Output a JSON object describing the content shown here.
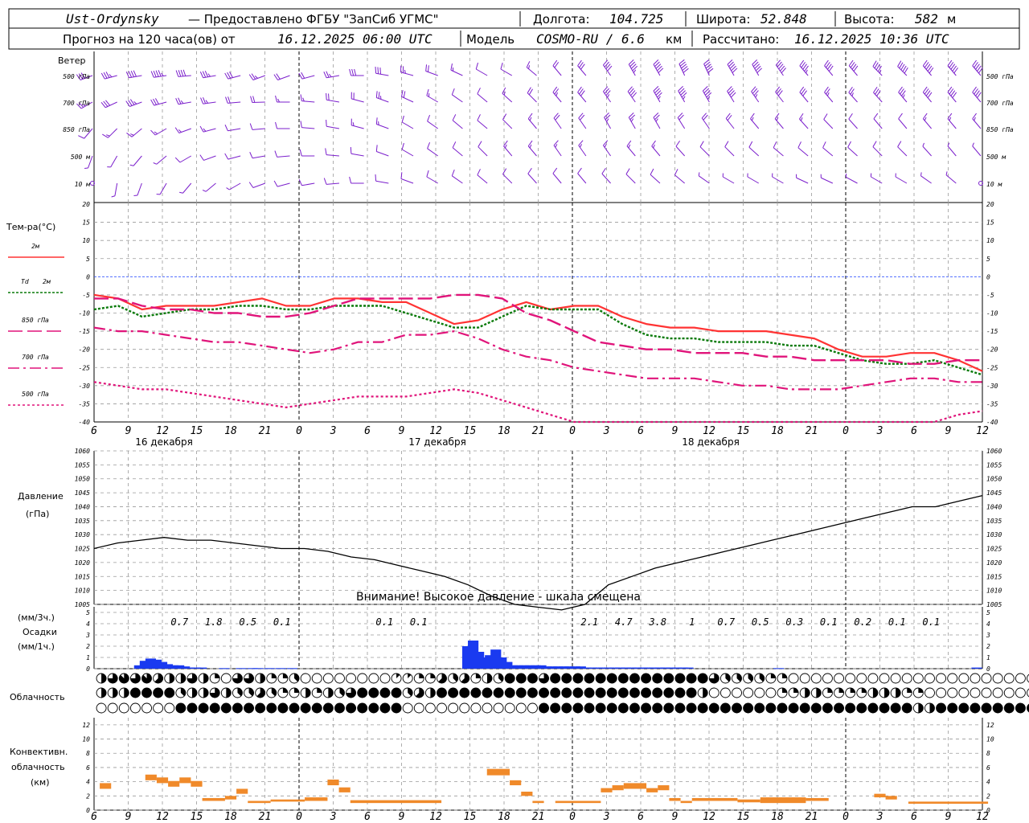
{
  "header": {
    "line1": {
      "station": "Ust-Ordynsky",
      "provider": "— Предоставлено ФГБУ \"ЗапСиб УГМС\"",
      "lon_label": "Долгота:",
      "lon_value": "104.725",
      "lat_label": "Широта:",
      "lat_value": "52.848",
      "alt_label": "Высота:",
      "alt_value": "582",
      "alt_unit": "м"
    },
    "line2": {
      "forecast_label": "Прогноз на 120 часа(ов) от",
      "forecast_start": "16.12.2025 06:00 UTC",
      "model_label": "Модель",
      "model_name": "COSMO-RU / 6.6",
      "model_unit": "км",
      "calc_label": "Рассчитано:",
      "calc_time": "16.12.2025 10:36 UTC"
    }
  },
  "labels": {
    "wind_title": "Ветер",
    "wind_levels": [
      "500 гПа",
      "700 гПа",
      "850 гПа",
      "500 м",
      "10 м"
    ],
    "temp_title": "Тем-ра(°С)",
    "temp_legend": [
      "2м",
      "Td 2м",
      "850 гПа",
      "700 гПа",
      "500 гПа"
    ],
    "pressure_title": "Давление",
    "pressure_unit": "(гПа)",
    "pressure_warning": "Внимание! Высокое давление - шкала смещена",
    "precip_unit_3h": "(мм/3ч.)",
    "precip_title": "Осадки",
    "precip_unit_1h": "(мм/1ч.)",
    "cloud_title": "Облачность",
    "conv_title_1": "Конвективн.",
    "conv_title_2": "облачность",
    "conv_unit": "(км)",
    "day_labels": [
      "16 декабря",
      "17 декабря",
      "18 декабря"
    ]
  },
  "colors": {
    "wind": "#7b1fcc",
    "t2m": "#ff3333",
    "td2m": "#0a7a0a",
    "t850": "#e0147a",
    "t700": "#e0147a",
    "t500": "#e0147a",
    "zero_line": "#3355ff",
    "precip": "#1a3af0",
    "conv": "#f08a2a"
  },
  "chart_data": [
    {
      "type": "line",
      "name": "temperature",
      "x_hours": [
        0,
        3,
        6,
        9,
        12,
        15,
        18,
        21,
        24,
        27,
        30,
        33,
        36,
        39,
        42,
        45,
        48,
        51,
        54,
        57,
        60,
        63,
        66,
        69,
        72,
        75,
        78,
        81,
        84,
        87,
        90,
        93,
        96,
        99,
        102,
        105,
        108,
        111,
        114,
        117,
        120,
        123,
        126,
        129,
        132,
        135,
        138,
        141,
        144,
        147,
        150,
        153,
        156,
        159,
        162,
        165,
        168,
        171,
        174,
        177,
        180,
        183,
        186,
        189,
        192,
        195,
        198,
        201,
        204,
        207,
        210,
        213,
        216,
        219,
        222,
        225,
        228,
        231,
        234
      ],
      "x_tick_labels": [
        "6",
        "9",
        "12",
        "15",
        "18",
        "21",
        "0",
        "3",
        "6",
        "9",
        "12",
        "15",
        "18",
        "21",
        "0",
        "3",
        "6",
        "9",
        "12",
        "15",
        "18",
        "21",
        "0",
        "3",
        "6",
        "9",
        "12"
      ],
      "ylim": [
        -40,
        20
      ],
      "y_ticks": [
        20,
        15,
        10,
        5,
        0,
        -5,
        -10,
        -15,
        -20,
        -25,
        -30,
        -35,
        -40
      ],
      "series": [
        {
          "name": "2м",
          "values": [
            -5,
            -6,
            -9,
            -8,
            -8,
            -8,
            -7,
            -6,
            -8,
            -8,
            -6,
            -6,
            -7,
            -7,
            -10,
            -13,
            -12,
            -9,
            -7,
            -9,
            -8,
            -8,
            -11,
            -13,
            -14,
            -14,
            -15,
            -15,
            -15,
            -16,
            -17,
            -20,
            -22,
            -22,
            -21,
            -21,
            -23,
            -26
          ]
        },
        {
          "name": "Td 2м",
          "values": [
            -9,
            -8,
            -11,
            -10,
            -9,
            -9,
            -8,
            -8,
            -9,
            -9,
            -8,
            -8,
            -8,
            -10,
            -12,
            -14,
            -14,
            -11,
            -8,
            -9,
            -9,
            -9,
            -13,
            -16,
            -17,
            -17,
            -18,
            -18,
            -18,
            -19,
            -19,
            -21,
            -23,
            -24,
            -24,
            -23,
            -25,
            -27
          ]
        },
        {
          "name": "850 гПа",
          "values": [
            -6,
            -6,
            -8,
            -9,
            -9,
            -10,
            -10,
            -11,
            -11,
            -10,
            -8,
            -6,
            -6,
            -6,
            -6,
            -5,
            -5,
            -6,
            -10,
            -12,
            -15,
            -18,
            -19,
            -20,
            -20,
            -21,
            -21,
            -21,
            -22,
            -22,
            -23,
            -23,
            -23,
            -23,
            -24,
            -24,
            -23,
            -23
          ]
        },
        {
          "name": "700 гПа",
          "values": [
            -14,
            -15,
            -15,
            -16,
            -17,
            -18,
            -18,
            -19,
            -20,
            -21,
            -20,
            -18,
            -18,
            -16,
            -16,
            -15,
            -17,
            -20,
            -22,
            -23,
            -25,
            -26,
            -27,
            -28,
            -28,
            -28,
            -29,
            -30,
            -30,
            -31,
            -31,
            -31,
            -30,
            -29,
            -28,
            -28,
            -29,
            -29
          ]
        },
        {
          "name": "500 гПа",
          "values": [
            -29,
            -30,
            -31,
            -31,
            -32,
            -33,
            -34,
            -35,
            -36,
            -35,
            -34,
            -33,
            -33,
            -33,
            -32,
            -31,
            -32,
            -34,
            -36,
            -38,
            -40,
            -41,
            -42,
            -43,
            -44,
            -45,
            -45,
            -45,
            -45,
            -44,
            -44,
            -44,
            -43,
            -43,
            -42,
            -40,
            -38,
            -37
          ]
        }
      ]
    },
    {
      "type": "line",
      "name": "pressure",
      "ylim": [
        1005,
        1060
      ],
      "y_ticks": [
        1060,
        1055,
        1050,
        1045,
        1040,
        1035,
        1030,
        1025,
        1020,
        1015,
        1010,
        1005
      ],
      "values": [
        1025,
        1027,
        1028,
        1029,
        1028,
        1028,
        1027,
        1026,
        1025,
        1025,
        1024,
        1022,
        1021,
        1019,
        1017,
        1015,
        1012,
        1008,
        1005,
        1004,
        1003,
        1005,
        1012,
        1015,
        1018,
        1020,
        1022,
        1024,
        1026,
        1028,
        1030,
        1032,
        1034,
        1036,
        1038,
        1040,
        1040,
        1042,
        1044
      ]
    },
    {
      "type": "bar",
      "name": "precipitation",
      "ylim": [
        0,
        5
      ],
      "y_ticks": [
        5,
        4,
        3,
        2,
        1,
        0
      ],
      "hourly_values": [
        0,
        0,
        0,
        0,
        0,
        0,
        0,
        0.3,
        0.7,
        0.9,
        0.8,
        0.6,
        0.4,
        0.3,
        0.3,
        0.2,
        0.1,
        0.1,
        0.1,
        0,
        0,
        0,
        0.05,
        0,
        0,
        0.05,
        0,
        0.05,
        0.05,
        0,
        0.05,
        0,
        0.05,
        0,
        0.05,
        0,
        0,
        0,
        0,
        0,
        0,
        0,
        0,
        0,
        0,
        0,
        0,
        0,
        0,
        0,
        0,
        0,
        0,
        0,
        0,
        0,
        0,
        0,
        0,
        0,
        0,
        0,
        0,
        0,
        0,
        2.0,
        2.5,
        1.5,
        1.0,
        1.2,
        1.7,
        1.0,
        0.6,
        0.3,
        0.3,
        0.3,
        0.3,
        0.3,
        0.3,
        0.2,
        0.2,
        0.2,
        0.2,
        0.2,
        0.2,
        0.2,
        0.1,
        0.1,
        0.1,
        0.1,
        0.1,
        0.1,
        0.1,
        0.1,
        0.1,
        0.1,
        0.1,
        0.1,
        0.1,
        0.1,
        0.1,
        0.1,
        0.1,
        0.1,
        0.1,
        0,
        0,
        0,
        0,
        0,
        0,
        0,
        0,
        0,
        0,
        0,
        0,
        0,
        0,
        0,
        0.05,
        0,
        0,
        0,
        0,
        0,
        0,
        0,
        0,
        0,
        0,
        0,
        0,
        0,
        0,
        0,
        0,
        0,
        0,
        0,
        0,
        0,
        0,
        0,
        0,
        0,
        0,
        0,
        0,
        0,
        0,
        0,
        0,
        0,
        0,
        0.1,
        0
      ],
      "sum3h_labels": [
        {
          "hour": 9,
          "text": "0.7"
        },
        {
          "hour": 12,
          "text": "1.8"
        },
        {
          "hour": 15,
          "text": "0.5"
        },
        {
          "hour": 18,
          "text": "0.1"
        },
        {
          "hour": 27,
          "text": "0.1"
        },
        {
          "hour": 30,
          "text": "0.1"
        },
        {
          "hour": 45,
          "text": "2.1"
        },
        {
          "hour": 48,
          "text": "4.7"
        },
        {
          "hour": 51,
          "text": "3.8"
        },
        {
          "hour": 54,
          "text": "1"
        },
        {
          "hour": 57,
          "text": "0.7"
        },
        {
          "hour": 60,
          "text": "0.5"
        },
        {
          "hour": 63,
          "text": "0.3"
        },
        {
          "hour": 66,
          "text": "0.1"
        },
        {
          "hour": 69,
          "text": "0.2"
        },
        {
          "hour": 72,
          "text": "0.1"
        },
        {
          "hour": 75,
          "text": "0.1"
        },
        {
          "hour": 90,
          "text": "0.1"
        }
      ]
    },
    {
      "type": "heatmap",
      "name": "cloud_cover",
      "rows": [
        "upper",
        "middle",
        "lower"
      ],
      "hourly_octas_upper": [
        4,
        6,
        7,
        6,
        7,
        5,
        4,
        4,
        6,
        4,
        2,
        0,
        6,
        6,
        4,
        2,
        2,
        3,
        0,
        0,
        0,
        0,
        0,
        0,
        0,
        0,
        1,
        1,
        2,
        2,
        5,
        3,
        5,
        2,
        4,
        3,
        8,
        8,
        8,
        6,
        8,
        8,
        8,
        8,
        8,
        8,
        8,
        8,
        8,
        8,
        8,
        8,
        8,
        8,
        6,
        3,
        3,
        3,
        3,
        2,
        2,
        0,
        0,
        0,
        0,
        0,
        0,
        0,
        0,
        0,
        0,
        0,
        0,
        0,
        0,
        0,
        0,
        0,
        0,
        0,
        0,
        0,
        0,
        0
      ],
      "hourly_octas_middle": [
        4,
        4,
        4,
        8,
        8,
        8,
        8,
        3,
        4,
        4,
        6,
        4,
        3,
        3,
        5,
        3,
        2,
        2,
        4,
        2,
        4,
        3,
        6,
        8,
        8,
        8,
        8,
        3,
        5,
        4,
        8,
        8,
        8,
        8,
        8,
        8,
        8,
        8,
        8,
        8,
        8,
        8,
        8,
        8,
        8,
        8,
        8,
        8,
        8,
        8,
        8,
        8,
        8,
        4,
        0,
        0,
        0,
        0,
        0,
        0,
        2,
        2,
        4,
        4,
        2,
        2,
        2,
        2,
        4,
        4,
        4,
        2,
        2,
        0,
        0,
        0,
        0,
        0,
        0,
        0,
        0,
        0,
        0,
        0
      ],
      "hourly_octas_lower": [
        0,
        0,
        0,
        0,
        0,
        0,
        0,
        8,
        8,
        8,
        8,
        8,
        8,
        8,
        8,
        8,
        8,
        8,
        8,
        8,
        8,
        8,
        8,
        8,
        8,
        8,
        8,
        0,
        0,
        0,
        0,
        0,
        0,
        0,
        0,
        0,
        0,
        0,
        0,
        8,
        8,
        8,
        8,
        8,
        8,
        8,
        8,
        8,
        8,
        8,
        8,
        8,
        8,
        8,
        8,
        8,
        8,
        8,
        8,
        8,
        8,
        8,
        8,
        8,
        8,
        8,
        8,
        8,
        8,
        8,
        8,
        8,
        4,
        4,
        8,
        8,
        8,
        8,
        8,
        8,
        8,
        8,
        8,
        8
      ]
    },
    {
      "type": "bar",
      "name": "convective_cloud",
      "ylim": [
        0,
        13
      ],
      "y_ticks": [
        12,
        10,
        8,
        6,
        4,
        2,
        0
      ],
      "segments": [
        {
          "h0": 0.5,
          "h1": 1.5,
          "base": 3.0,
          "top": 3.8
        },
        {
          "h0": 4.5,
          "h1": 5.5,
          "base": 4.2,
          "top": 5.0
        },
        {
          "h0": 5.5,
          "h1": 6.5,
          "base": 3.8,
          "top": 4.6
        },
        {
          "h0": 6.5,
          "h1": 7.5,
          "base": 3.3,
          "top": 4.1
        },
        {
          "h0": 7.5,
          "h1": 8.5,
          "base": 3.8,
          "top": 4.6
        },
        {
          "h0": 8.5,
          "h1": 9.5,
          "base": 3.3,
          "top": 4.1
        },
        {
          "h0": 9.5,
          "h1": 11.5,
          "base": 1.3,
          "top": 1.7
        },
        {
          "h0": 11.5,
          "h1": 12.5,
          "base": 1.5,
          "top": 2.0
        },
        {
          "h0": 12.5,
          "h1": 13.5,
          "base": 2.3,
          "top": 3.0
        },
        {
          "h0": 13.5,
          "h1": 15.5,
          "base": 1.0,
          "top": 1.3
        },
        {
          "h0": 15.5,
          "h1": 18.5,
          "base": 1.2,
          "top": 1.5
        },
        {
          "h0": 18.5,
          "h1": 20.5,
          "base": 1.3,
          "top": 1.8
        },
        {
          "h0": 20.5,
          "h1": 21.5,
          "base": 3.5,
          "top": 4.3
        },
        {
          "h0": 21.5,
          "h1": 22.5,
          "base": 2.5,
          "top": 3.2
        },
        {
          "h0": 22.5,
          "h1": 30.5,
          "base": 1.0,
          "top": 1.4
        },
        {
          "h0": 34.5,
          "h1": 36.5,
          "base": 4.9,
          "top": 5.8
        },
        {
          "h0": 36.5,
          "h1": 37.5,
          "base": 3.5,
          "top": 4.2
        },
        {
          "h0": 37.5,
          "h1": 38.5,
          "base": 2.0,
          "top": 2.6
        },
        {
          "h0": 38.5,
          "h1": 39.5,
          "base": 1.0,
          "top": 1.3
        },
        {
          "h0": 40.5,
          "h1": 44.5,
          "base": 1.0,
          "top": 1.3
        },
        {
          "h0": 44.5,
          "h1": 45.5,
          "base": 2.5,
          "top": 3.1
        },
        {
          "h0": 45.5,
          "h1": 46.5,
          "base": 2.8,
          "top": 3.5
        },
        {
          "h0": 46.5,
          "h1": 48.5,
          "base": 3.0,
          "top": 3.8
        },
        {
          "h0": 48.5,
          "h1": 49.5,
          "base": 2.5,
          "top": 3.1
        },
        {
          "h0": 49.5,
          "h1": 50.5,
          "base": 2.8,
          "top": 3.5
        },
        {
          "h0": 50.5,
          "h1": 51.5,
          "base": 1.3,
          "top": 1.7
        },
        {
          "h0": 51.5,
          "h1": 52.5,
          "base": 1.0,
          "top": 1.3
        },
        {
          "h0": 52.5,
          "h1": 56.5,
          "base": 1.3,
          "top": 1.7
        },
        {
          "h0": 56.5,
          "h1": 58.5,
          "base": 1.1,
          "top": 1.5
        },
        {
          "h0": 58.5,
          "h1": 62.5,
          "base": 1.0,
          "top": 1.8
        },
        {
          "h0": 62.5,
          "h1": 64.5,
          "base": 1.3,
          "top": 1.7
        },
        {
          "h0": 68.5,
          "h1": 69.5,
          "base": 1.8,
          "top": 2.3
        },
        {
          "h0": 69.5,
          "h1": 70.5,
          "base": 1.5,
          "top": 2.0
        },
        {
          "h0": 71.5,
          "h1": 78.5,
          "base": 0.9,
          "top": 1.2
        }
      ]
    }
  ]
}
